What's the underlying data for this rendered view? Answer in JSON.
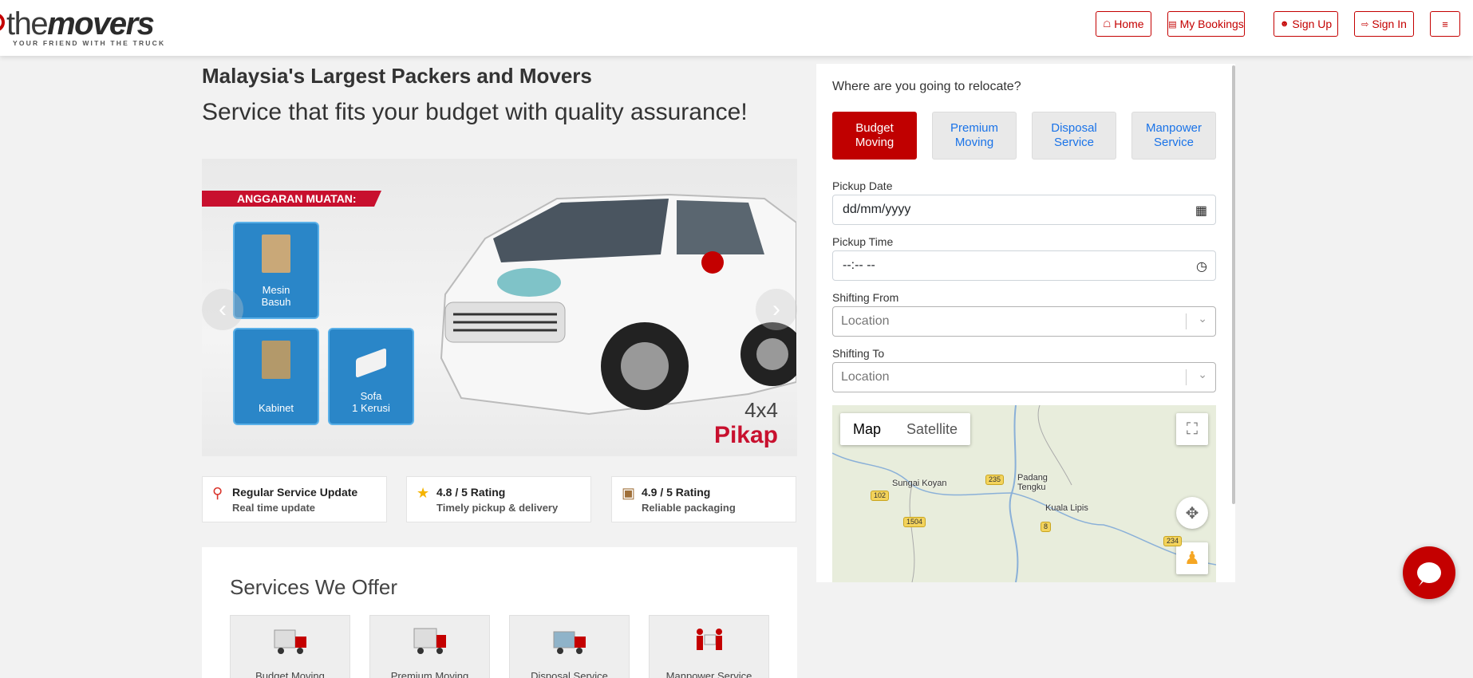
{
  "brand": {
    "name_light": "the",
    "name_bold": "movers",
    "tagline": "YOUR FRIEND WITH THE TRUCK",
    "accent": "#c40000"
  },
  "nav": {
    "home": "Home",
    "bookings": "My Bookings",
    "signup": "Sign Up",
    "signin": "Sign In",
    "menu_icon": "hamburger-icon"
  },
  "hero": {
    "title": "Malaysia's Largest Packers and Movers",
    "subtitle": "Service that fits your budget with quality assurance!"
  },
  "carousel": {
    "banner": "ANGGARAN MUATAN:",
    "items": [
      "Mesin\nBasuh",
      "Kabinet",
      "Sofa\n1 Kerusi"
    ],
    "vehicle_size": "4x4",
    "vehicle_name": "Pikap",
    "prev_icon": "chevron-left-icon",
    "next_icon": "chevron-right-icon"
  },
  "features": [
    {
      "icon": "map-pin-icon",
      "title": "Regular Service Update",
      "sub": "Real time update"
    },
    {
      "icon": "star-icon",
      "title": "4.8 / 5 Rating",
      "sub": "Timely pickup & delivery"
    },
    {
      "icon": "package-icon",
      "title": "4.9 / 5 Rating",
      "sub": "Reliable packaging"
    }
  ],
  "services": {
    "heading": "Services We Offer",
    "items": [
      "Budget Moving",
      "Premium Moving",
      "Disposal Service",
      "Manpower Service"
    ]
  },
  "booking": {
    "question": "Where are you going to relocate?",
    "options": [
      "Budget\nMoving",
      "Premium\nMoving",
      "Disposal\nService",
      "Manpower\nService"
    ],
    "selected_option": "Budget Moving",
    "pickup_date_label": "Pickup Date",
    "pickup_date_value": "dd/mm/yyyy",
    "pickup_time_label": "Pickup Time",
    "pickup_time_value": "--:-- --",
    "from_label": "Shifting From",
    "from_placeholder": "Location",
    "to_label": "Shifting To",
    "to_placeholder": "Location"
  },
  "map": {
    "type_map": "Map",
    "type_satellite": "Satellite",
    "places": [
      "Sungai Koyan",
      "Padang\nTengku",
      "Kuala Lipis"
    ],
    "roads": [
      "102",
      "235",
      "1504",
      "8",
      "234"
    ]
  },
  "chat": {
    "icon": "chat-bubble-icon"
  }
}
